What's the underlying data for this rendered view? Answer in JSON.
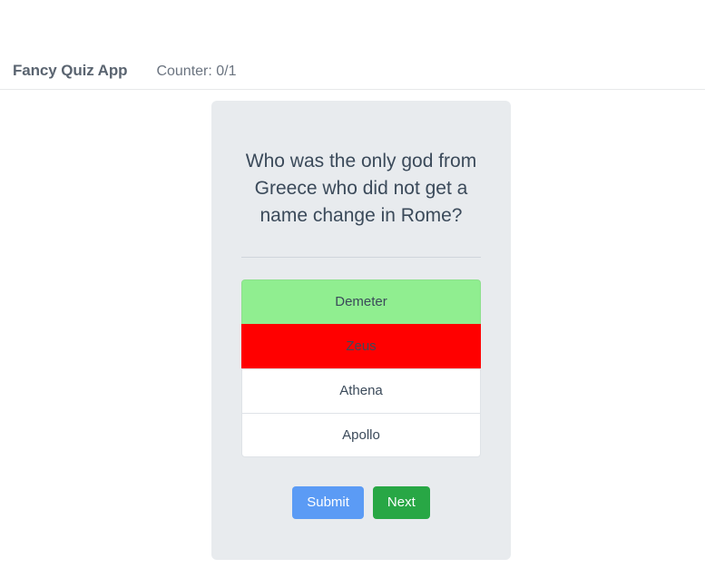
{
  "header": {
    "brand": "Fancy Quiz App",
    "counter": "Counter: 0/1"
  },
  "quiz": {
    "question": "Who was the only god from Greece who did not get a name change in Rome?",
    "options": [
      {
        "label": "Demeter",
        "state": "correct"
      },
      {
        "label": "Zeus",
        "state": "wrong"
      },
      {
        "label": "Athena",
        "state": "default"
      },
      {
        "label": "Apollo",
        "state": "default"
      }
    ],
    "buttons": {
      "submit": "Submit",
      "next": "Next"
    }
  },
  "colors": {
    "page_background": "#ffffff",
    "card_background": "#e8ebee",
    "text": "#3b4a5a",
    "brand_text": "#5a6470",
    "option_correct": "#90ee90",
    "option_wrong": "#ff0000",
    "option_default": "#ffffff",
    "submit_button": "#5b9bf5",
    "next_button": "#28a745",
    "divider": "#cfd5db"
  }
}
